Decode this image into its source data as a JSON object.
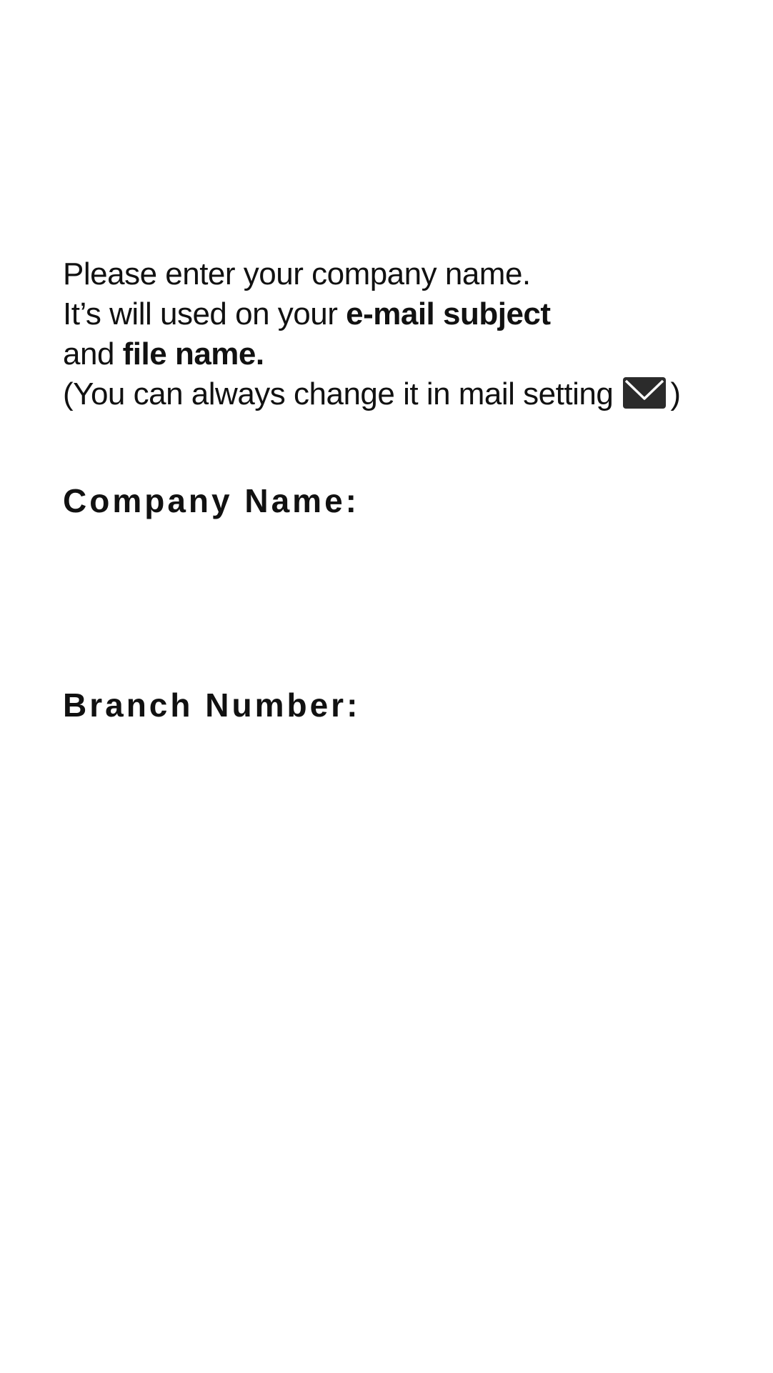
{
  "intro": {
    "line1": "Please enter your company name.",
    "line2_prefix": "It’s will used on your ",
    "line2_bold": "e-mail subject",
    "line3_prefix": "and ",
    "line3_bold": "file name.",
    "line4_prefix": "(You can always change it in mail setting",
    "line4_suffix": ")",
    "icon": "mail-icon"
  },
  "form": {
    "company_label": "Company Name:",
    "company_value": "",
    "branch_label": "Branch Number:",
    "branch_value": ""
  },
  "colors": {
    "text": "#111111",
    "icon": "#2b2b2b",
    "background": "#ffffff"
  }
}
